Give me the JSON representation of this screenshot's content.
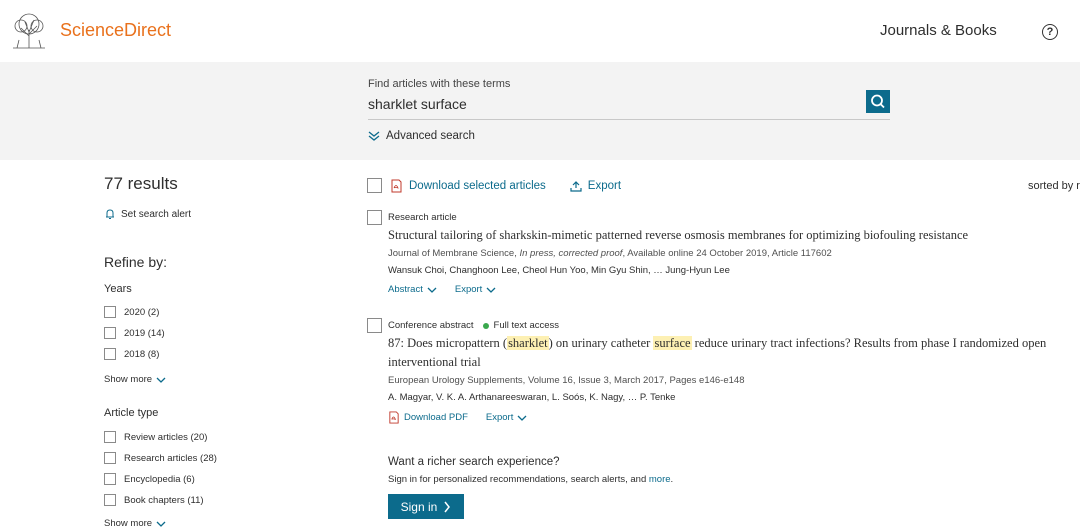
{
  "header": {
    "brand": "ScienceDirect",
    "journals_link": "Journals & Books",
    "help_icon": "?"
  },
  "search": {
    "label": "Find articles with these terms",
    "query": "sharklet surface",
    "advanced": "Advanced search"
  },
  "left": {
    "results_count": "77 results",
    "alert": "Set search alert",
    "refine": "Refine by:",
    "years": {
      "title": "Years",
      "items": [
        "2020 (2)",
        "2019 (14)",
        "2018 (8)"
      ],
      "show_more": "Show more"
    },
    "article_type": {
      "title": "Article type",
      "items": [
        "Review articles (20)",
        "Research articles (28)",
        "Encyclopedia (6)",
        "Book chapters (11)"
      ],
      "show_more": "Show more"
    }
  },
  "toolbar": {
    "download": "Download selected articles",
    "export": "Export",
    "sorted": "sorted by r"
  },
  "articles": [
    {
      "type": "Research article",
      "title": "Structural tailoring of sharkskin-mimetic patterned reverse osmosis membranes for optimizing biofouling resistance",
      "meta_a": "Journal of Membrane Science, ",
      "meta_b": "In press, corrected proof",
      "meta_c": ", Available online 24 October 2019, Article 117602",
      "authors": "Wansuk Choi, Changhoon Lee, Cheol Hun Yoo, Min Gyu Shin, … Jung-Hyun Lee",
      "abstract": "Abstract",
      "export": "Export"
    },
    {
      "type": "Conference abstract",
      "access": "Full text access",
      "title_1": "87: Does micropattern (",
      "title_hl1": "sharklet",
      "title_2": ") on urinary catheter ",
      "title_hl2": "surface",
      "title_3": " reduce urinary tract infections? Results from phase I randomized open",
      "title_line2": "interventional trial",
      "meta": "European Urology Supplements, Volume 16, Issue 3, March 2017, Pages e146-e148",
      "authors": "A. Magyar, V. K. A. Arthanareeswaran, L. Soós, K. Nagy, … P. Tenke",
      "pdf": "Download PDF",
      "export": "Export"
    }
  ],
  "signin_box": {
    "heading": "Want a richer search experience?",
    "sub_a": "Sign in for personalized recommendations, search alerts, and ",
    "sub_more": "more",
    "sub_end": ".",
    "button": "Sign in"
  },
  "colors": {
    "brand": "#e9711c",
    "link": "#0c6b8c",
    "band": "#f3f3f3",
    "highlight": "#fdf0b3",
    "access_dot": "#3aa84d"
  }
}
